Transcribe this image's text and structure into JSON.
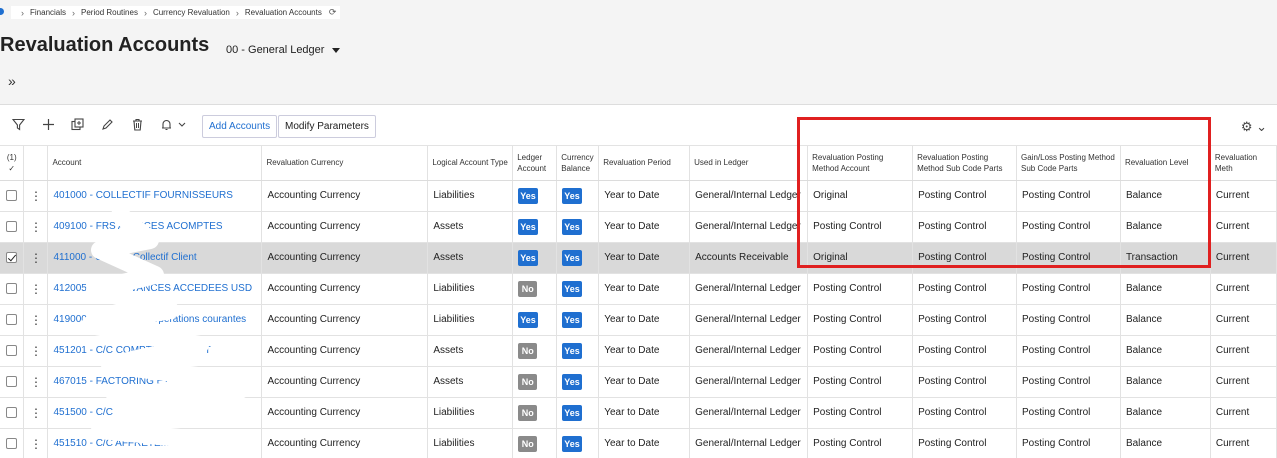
{
  "breadcrumb": {
    "items": [
      "Financials",
      "Period Routines",
      "Currency Revaluation",
      "Revaluation Accounts"
    ]
  },
  "page": {
    "title": "Revaluation Accounts",
    "ledger": "00 - General Ledger"
  },
  "toolbar": {
    "add_accounts": "Add Accounts",
    "modify_parameters": "Modify Parameters"
  },
  "table": {
    "selected_count": "(1)",
    "columns": {
      "account": "Account",
      "reval_currency": "Revaluation Currency",
      "logical_type": "Logical Account Type",
      "ledger_account": "Ledger Account",
      "currency_balance": "Currency Balance",
      "reval_period": "Revaluation Period",
      "used_in_ledger": "Used in Ledger",
      "posting_method_account": "Revaluation Posting Method Account",
      "posting_method_subcode": "Revaluation Posting Method Sub Code Parts",
      "gainloss_subcode": "Gain/Loss Posting Method Sub Code Parts",
      "reval_level": "Revaluation Level",
      "reval_method": "Revaluation Meth"
    },
    "rows": [
      {
        "account": "401000 - COLLECTIF FOURNISSEURS",
        "currency": "Accounting Currency",
        "type": "Liabilities",
        "ledger": "Yes",
        "balance": "Yes",
        "period": "Year to Date",
        "used": "General/Internal Ledger",
        "pma": "Original",
        "pms": "Posting Control",
        "gls": "Posting Control",
        "level": "Balance",
        "method": "Current",
        "selected": false
      },
      {
        "account": "409100 - FRS AVANCES ACOMPTES",
        "currency": "Accounting Currency",
        "type": "Assets",
        "ledger": "Yes",
        "balance": "Yes",
        "period": "Year to Date",
        "used": "General/Internal Ledger",
        "pma": "Posting Control",
        "pms": "Posting Control",
        "gls": "Posting Control",
        "level": "Balance",
        "method": "Current",
        "selected": false
      },
      {
        "account": "411000 - Compte Collectif Client",
        "currency": "Accounting Currency",
        "type": "Assets",
        "ledger": "Yes",
        "balance": "Yes",
        "period": "Year to Date",
        "used": "Accounts Receivable",
        "pma": "Original",
        "pms": "Posting Control",
        "gls": "Posting Control",
        "level": "Transaction",
        "method": "Current",
        "selected": true
      },
      {
        "account": "412005 - CPTE AVANCES ACCEDEES USD",
        "currency": "Accounting Currency",
        "type": "Liabilities",
        "ledger": "No",
        "balance": "Yes",
        "period": "Year to Date",
        "used": "General/Internal Ledger",
        "pma": "Posting Control",
        "pms": "Posting Control",
        "gls": "Posting Control",
        "level": "Balance",
        "method": "Current",
        "selected": false
      },
      {
        "account": "419000 - Avances sur opérations courantes",
        "currency": "Accounting Currency",
        "type": "Liabilities",
        "ledger": "Yes",
        "balance": "Yes",
        "period": "Year to Date",
        "used": "General/Internal Ledger",
        "pma": "Posting Control",
        "pms": "Posting Control",
        "gls": "Posting Control",
        "level": "Balance",
        "method": "Current",
        "selected": false
      },
      {
        "account": "451201 - C/C COMPTE COURANT",
        "currency": "Accounting Currency",
        "type": "Assets",
        "ledger": "No",
        "balance": "Yes",
        "period": "Year to Date",
        "used": "General/Internal Ledger",
        "pma": "Posting Control",
        "pms": "Posting Control",
        "gls": "Posting Control",
        "level": "Balance",
        "method": "Current",
        "selected": false
      },
      {
        "account": "467015 - FACTORING ET GARANTIES",
        "currency": "Accounting Currency",
        "type": "Assets",
        "ledger": "No",
        "balance": "Yes",
        "period": "Year to Date",
        "used": "General/Internal Ledger",
        "pma": "Posting Control",
        "pms": "Posting Control",
        "gls": "Posting Control",
        "level": "Balance",
        "method": "Current",
        "selected": false
      },
      {
        "account": "451500 - C/C",
        "currency": "Accounting Currency",
        "type": "Liabilities",
        "ledger": "No",
        "balance": "Yes",
        "period": "Year to Date",
        "used": "General/Internal Ledger",
        "pma": "Posting Control",
        "pms": "Posting Control",
        "gls": "Posting Control",
        "level": "Balance",
        "method": "Current",
        "selected": false
      },
      {
        "account": "451510 - C/C AFFRETEMENT",
        "currency": "Accounting Currency",
        "type": "Liabilities",
        "ledger": "No",
        "balance": "Yes",
        "period": "Year to Date",
        "used": "General/Internal Ledger",
        "pma": "Posting Control",
        "pms": "Posting Control",
        "gls": "Posting Control",
        "level": "Balance",
        "method": "Current",
        "selected": false
      }
    ]
  },
  "colors": {
    "accent": "#1f6fd0",
    "highlight": "#e02020"
  }
}
